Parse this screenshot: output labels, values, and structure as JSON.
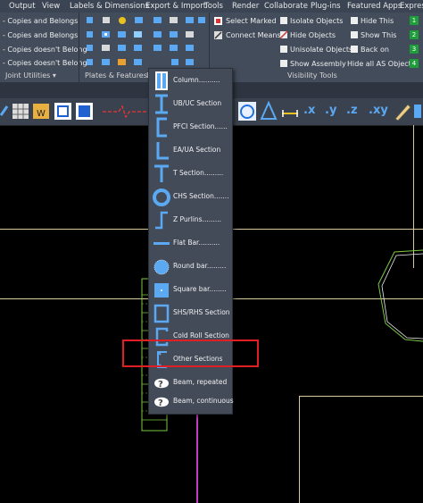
{
  "menubar": {
    "items": [
      "Output",
      "View",
      "Labels & Dimensions",
      "Export & Import",
      "Tools",
      "Render",
      "Collaborate",
      "Plug-ins",
      "Featured Apps",
      "Express"
    ]
  },
  "ribbon": {
    "left_items": [
      "- Copies and Belongs",
      "- Copies and Belongs",
      "- Copies doesn't Belong",
      "- Copies doesn't Belong"
    ],
    "left_section": "Joint Utilities",
    "mid_section": "Plates & Features",
    "mid_section_partial": "E",
    "select_marked": "Select Marked",
    "connect_means": "Connect Means",
    "isolate_objects": "Isolate Objects",
    "hide_objects": "Hide Objects",
    "unisolate_objects": "Unisolate Objects",
    "show_assembly": "Show Assembly",
    "hide_this": "Hide This",
    "show_this": "Show This",
    "back_on": "Back on",
    "hide_all": "Hide all AS Objects",
    "visibility_section": "Visibility Tools",
    "right_numbers": [
      "1",
      "2",
      "3",
      "4"
    ]
  },
  "toolbar": {
    "axis_labels": [
      ".x",
      ".y",
      ".z",
      ".xy"
    ]
  },
  "dropdown": {
    "items": [
      {
        "label": "Column..........",
        "icon": "column-icon"
      },
      {
        "label": "UB/UC Section",
        "icon": "ub-uc-section-icon"
      },
      {
        "label": "PFCI Section......",
        "icon": "pfc-section-icon"
      },
      {
        "label": "EA/UA Section",
        "icon": "angle-section-icon"
      },
      {
        "label": "T Section.........",
        "icon": "t-section-icon"
      },
      {
        "label": "CHS Section.......",
        "icon": "chs-section-icon"
      },
      {
        "label": "Z Purlins.........",
        "icon": "z-purlin-icon"
      },
      {
        "label": "Flat Bar..........",
        "icon": "flat-bar-icon"
      },
      {
        "label": "Round bar.........",
        "icon": "round-bar-icon"
      },
      {
        "label": "Square bar........",
        "icon": "square-bar-icon"
      },
      {
        "label": "SHS/RHS Section",
        "icon": "shs-rhs-section-icon"
      },
      {
        "label": "Cold Roll Section",
        "icon": "cold-roll-section-icon"
      },
      {
        "label": "Other Sections",
        "icon": "other-sections-icon"
      },
      {
        "label": "Beam, repeated",
        "icon": "beam-repeated-icon"
      },
      {
        "label": "Beam, continuous",
        "icon": "beam-continuous-icon"
      }
    ]
  },
  "colors": {
    "menu_bg": "#3b4453",
    "ribbon_bg": "#434c5b",
    "icon_blue": "#5aa9f2",
    "highlight": "#e01f25",
    "cad_line_tan": "#d9c9a0",
    "cad_line_green": "#7ac943",
    "cad_line_magenta": "#c03cc0"
  }
}
